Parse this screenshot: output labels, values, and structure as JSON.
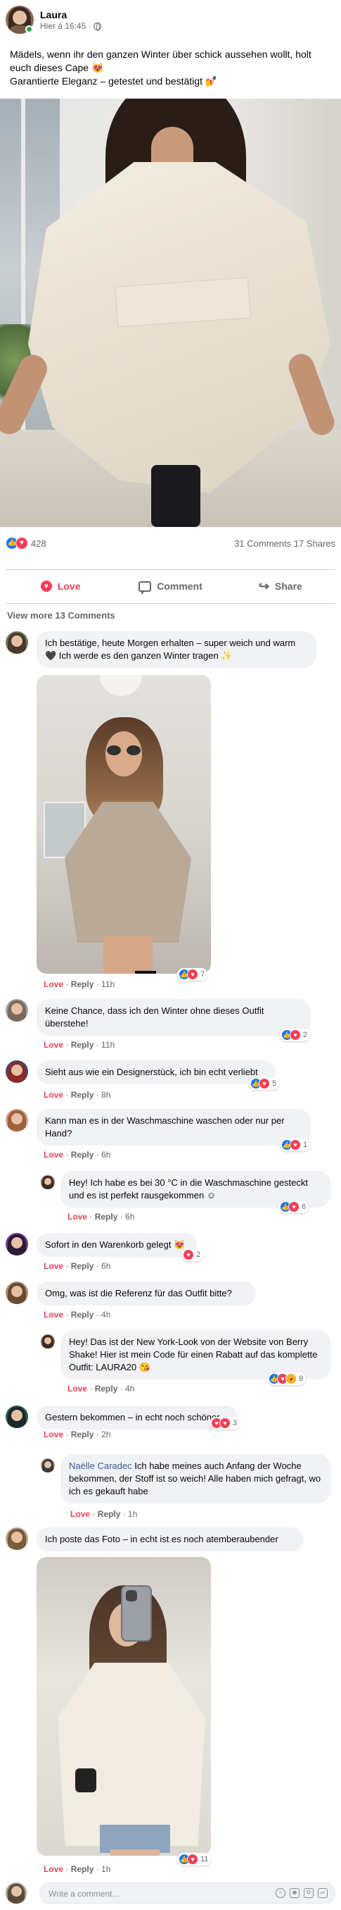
{
  "post": {
    "author": "Laura",
    "timestamp": "Hier à 16:45 ·",
    "privacy_icon": "globe-icon",
    "text_line1": "Mädels, wenn ihr den ganzen Winter über schick aussehen wollt, holt euch dieses Cape 😻",
    "text_line2": "Garantierte Eleganz – getestet und bestätigt 💅",
    "reactions_count": "428",
    "comments_shares": "31 Comments 17 Shares"
  },
  "actions": {
    "love": "Love",
    "comment": "Comment",
    "share": "Share"
  },
  "view_more": "View more 13 Comments",
  "comments": [
    {
      "text": "Ich bestätige, heute Morgen erhalten – super weich und warm 🖤  Ich werde es den ganzen Winter tragen ✨",
      "love": "Love",
      "reply": "Reply",
      "time": "11h",
      "reactions": "7"
    },
    {
      "text": "Keine Chance, dass ich den Winter ohne dieses Outfit überstehe!",
      "love": "Love",
      "reply": "Reply",
      "time": "11h",
      "reactions": "2"
    },
    {
      "text": "Sieht aus wie ein Designerstück, ich bin echt verliebt",
      "love": "Love",
      "reply": "Reply",
      "time": "8h",
      "reactions": "5"
    },
    {
      "text": "Kann man es in der Waschmaschine waschen oder nur per Hand?",
      "love": "Love",
      "reply": "Reply",
      "time": "6h",
      "reactions": "1"
    },
    {
      "text": "Hey! Ich habe es bei 30 °C in die Waschmaschine gesteckt und es ist perfekt rausgekommen ☺",
      "love": "Love",
      "reply": "Reply",
      "time": "6h",
      "reactions": "6"
    },
    {
      "text": "Sofort in den Warenkorb gelegt 😻",
      "love": "Love",
      "reply": "Reply",
      "time": "6h",
      "reactions": "2"
    },
    {
      "text": "Omg, was ist die Referenz für das Outfit bitte?",
      "love": "Love",
      "reply": "Reply",
      "time": "4h"
    },
    {
      "text": "Hey! Das ist der New York-Look von der Website von Berry Shake! Hier ist mein Code für einen Rabatt auf das komplette Outfit: LAURA20 😘",
      "love": "Love",
      "reply": "Reply",
      "time": "4h",
      "reactions": "9"
    },
    {
      "text": "Gestern bekommen – in echt noch schöner",
      "love": "Love",
      "reply": "Reply",
      "time": "2h",
      "reactions": "3"
    },
    {
      "name": "Naëlle Caradec",
      "text": "Ich habe meines auch Anfang der Woche bekommen, der Stoff ist so weich! Alle haben mich gefragt, wo ich es gekauft habe",
      "love": "Love",
      "reply": "Reply",
      "time": "1h"
    },
    {
      "text": "Ich poste das Foto – in echt ist es noch atemberaubender",
      "love": "Love",
      "reply": "Reply",
      "time": "1h",
      "reactions": "11"
    }
  ],
  "write_comment": {
    "placeholder": "Write a comment..."
  },
  "colors": {
    "love": "#f33e58",
    "like": "#1877f2",
    "link": "#385898",
    "bubble": "#f0f2f5",
    "secondary": "#65676b"
  }
}
